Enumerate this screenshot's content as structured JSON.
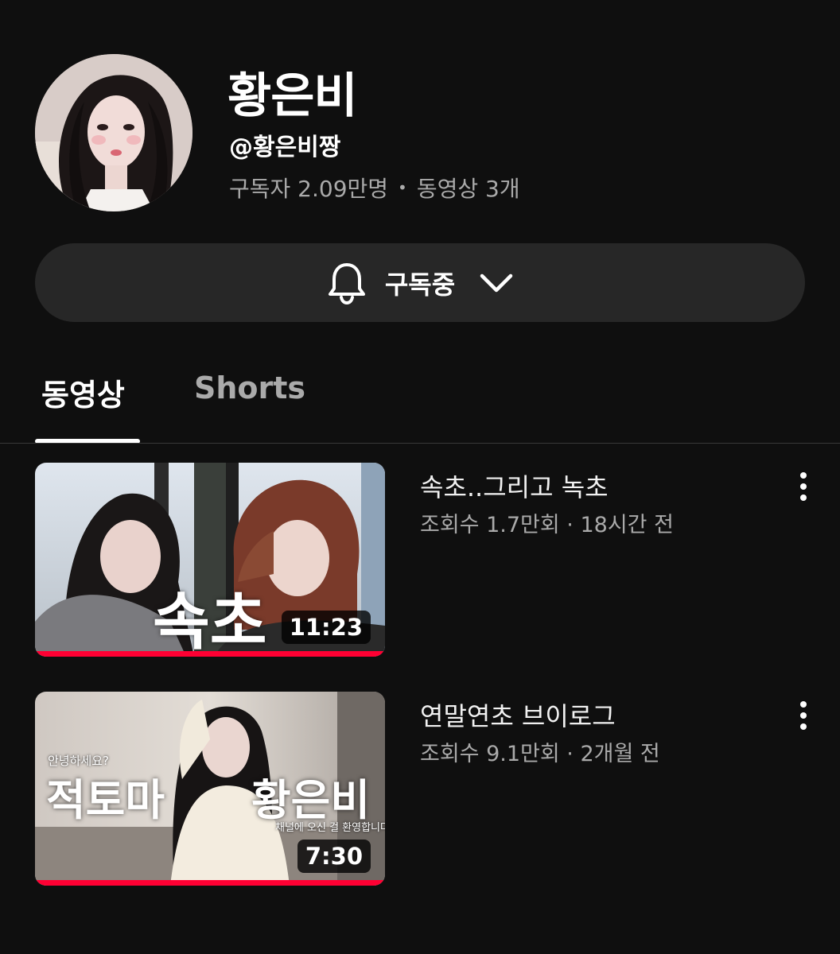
{
  "channel": {
    "name": "황은비",
    "handle": "@황은비짱",
    "subscribers": "구독자 2.09만명",
    "video_count": "동영상 3개"
  },
  "subscribe": {
    "label": "구독중"
  },
  "tabs": [
    {
      "label": "동영상",
      "active": true
    },
    {
      "label": "Shorts",
      "active": false
    }
  ],
  "videos": [
    {
      "title": "속초..그리고 녹초",
      "meta": "조회수 1.7만회 · 18시간 전",
      "duration": "11:23",
      "thumb_text": "속초",
      "watched_fraction": 1.0
    },
    {
      "title": "연말연초 브이로그",
      "meta": "조회수 9.1만회 · 2개월 전",
      "duration": "7:30",
      "thumb_caption_small": "안녕하세요?",
      "thumb_text_left": "적토마",
      "thumb_text_right": "황은비",
      "thumb_caption_bottom": "채널에 오신 걸 환영합니다",
      "watched_fraction": 1.0
    }
  ],
  "colors": {
    "background": "#0f0f0f",
    "button": "#272727",
    "progress": "#ff0033",
    "secondary_text": "#aaaaaa"
  }
}
